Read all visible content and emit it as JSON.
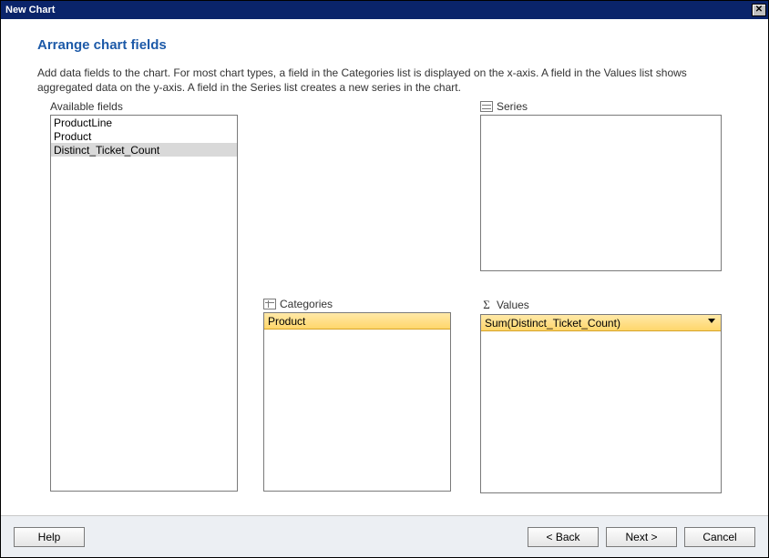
{
  "window": {
    "title": "New Chart",
    "close_label": "✕"
  },
  "page": {
    "title": "Arrange chart fields",
    "description": "Add data fields to the chart. For most chart types, a field in the Categories list is displayed on the x-axis. A field in the Values list shows aggregated data on the y-axis. A field in the Series list creates a new series in the chart."
  },
  "labels": {
    "available": "Available fields",
    "series": "Series",
    "categories": "Categories",
    "values": "Values"
  },
  "available_fields": [
    {
      "name": "ProductLine",
      "selected": false
    },
    {
      "name": "Product",
      "selected": false
    },
    {
      "name": "Distinct_Ticket_Count",
      "selected": true
    }
  ],
  "series_fields": [],
  "categories_fields": [
    {
      "display": "Product"
    }
  ],
  "values_fields": [
    {
      "display": "Sum(Distinct_Ticket_Count)",
      "has_dropdown": true
    }
  ],
  "buttons": {
    "help": "Help",
    "back": "< Back",
    "next": "Next >",
    "cancel": "Cancel"
  }
}
